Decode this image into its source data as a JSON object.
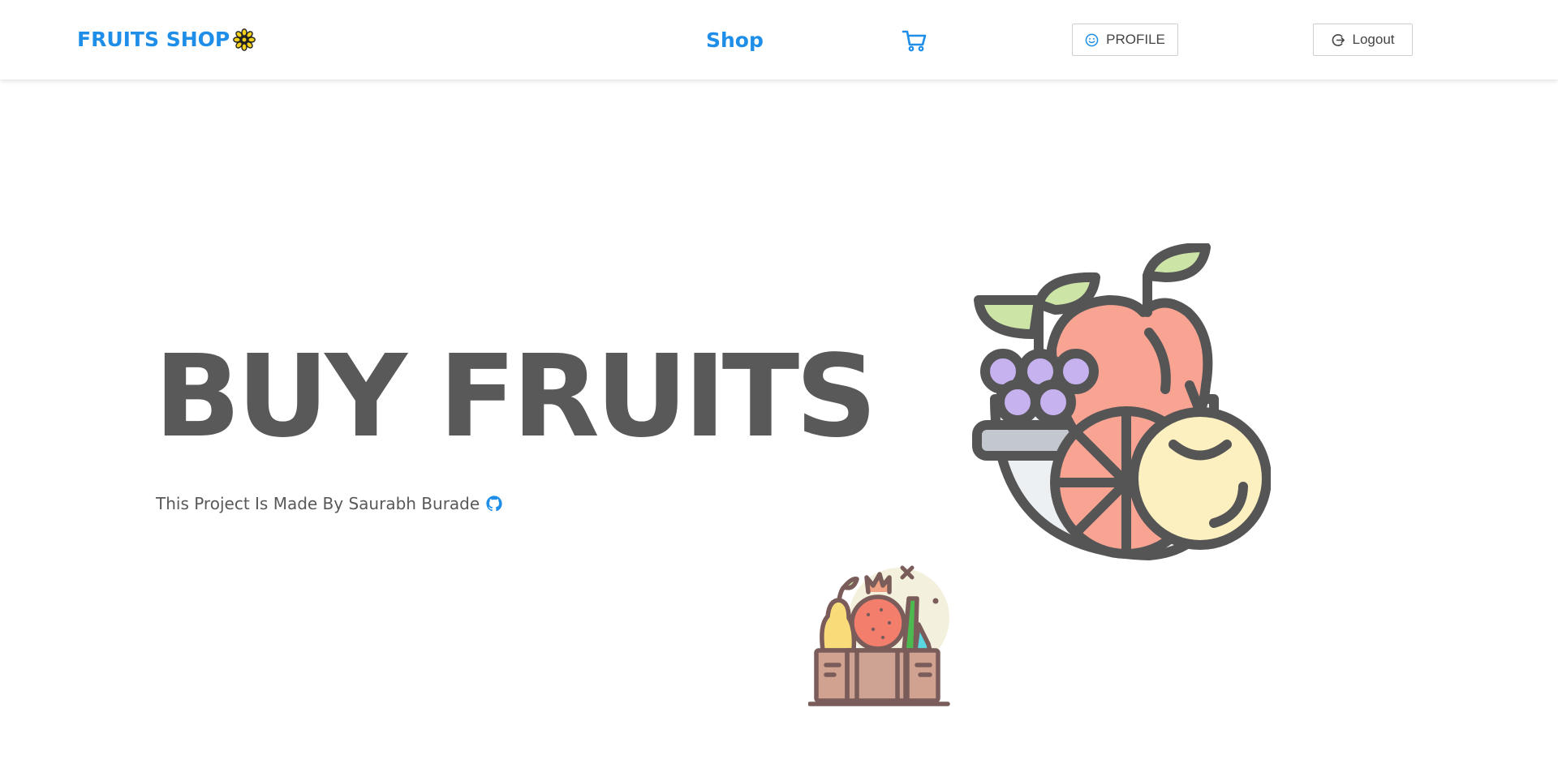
{
  "navbar": {
    "brand": "FRUITS SHOP",
    "brand_icon": "sunflower-icon",
    "shop_link": "Shop",
    "cart_icon": "shopping-cart-icon",
    "profile_label": "PROFILE",
    "profile_icon": "smile-icon",
    "logout_label": "Logout",
    "logout_icon": "logout-icon"
  },
  "hero": {
    "title": "BUY FRUITS",
    "credit": "This Project Is Made By Saurabh Burade",
    "credit_icon": "github-icon"
  },
  "illustrations": {
    "bowl": "fruit-bowl-illustration",
    "basket": "fruit-basket-illustration"
  },
  "colors": {
    "brand_blue": "#1e8ee8",
    "text_gray": "#595959",
    "apple": "#f9a493",
    "grape": "#c5b2ee",
    "leaf": "#cce5a6",
    "yellow_fruit": "#fdf0c0",
    "bowl": "#ecf0f3",
    "outline": "#555555"
  }
}
